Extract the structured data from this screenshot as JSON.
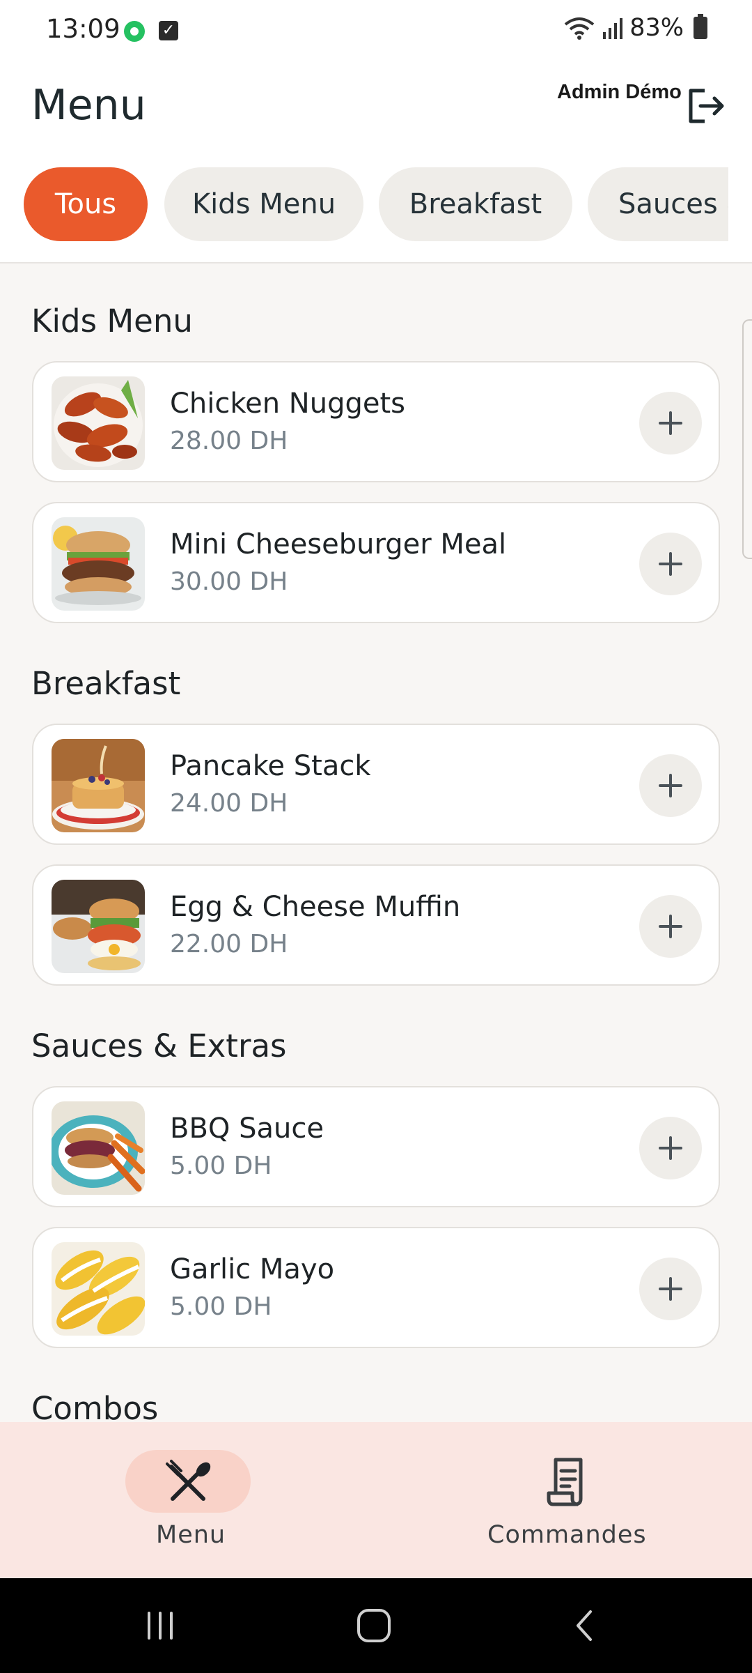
{
  "status_bar": {
    "time": "13:09",
    "battery": "83%",
    "icons": [
      "whatsapp-icon",
      "checkbox-icon",
      "wifi-icon",
      "signal-icon",
      "battery-icon"
    ]
  },
  "header": {
    "title": "Menu",
    "user_name": "Admin Démo",
    "logout_icon": "logout-icon"
  },
  "categories": [
    {
      "label": "Tous",
      "active": true
    },
    {
      "label": "Kids Menu",
      "active": false
    },
    {
      "label": "Breakfast",
      "active": false
    },
    {
      "label": "Sauces & Extras",
      "active": false
    }
  ],
  "sections": [
    {
      "title": "Kids Menu",
      "items": [
        {
          "name": "Chicken Nuggets",
          "price": "28.00 DH"
        },
        {
          "name": "Mini Cheeseburger Meal",
          "price": "30.00 DH"
        }
      ]
    },
    {
      "title": "Breakfast",
      "items": [
        {
          "name": "Pancake Stack",
          "price": "24.00 DH"
        },
        {
          "name": "Egg & Cheese Muffin",
          "price": "22.00 DH"
        }
      ]
    },
    {
      "title": "Sauces & Extras",
      "items": [
        {
          "name": "BBQ Sauce",
          "price": "5.00 DH"
        },
        {
          "name": "Garlic Mayo",
          "price": "5.00 DH"
        }
      ]
    },
    {
      "title": "Combos",
      "items": []
    }
  ],
  "bottom_nav": {
    "menu_label": "Menu",
    "orders_label": "Commandes"
  },
  "colors": {
    "accent": "#ea5a2c",
    "chip_bg": "#efede9",
    "nav_bg": "#fae6e2",
    "price_text": "#76818a"
  }
}
